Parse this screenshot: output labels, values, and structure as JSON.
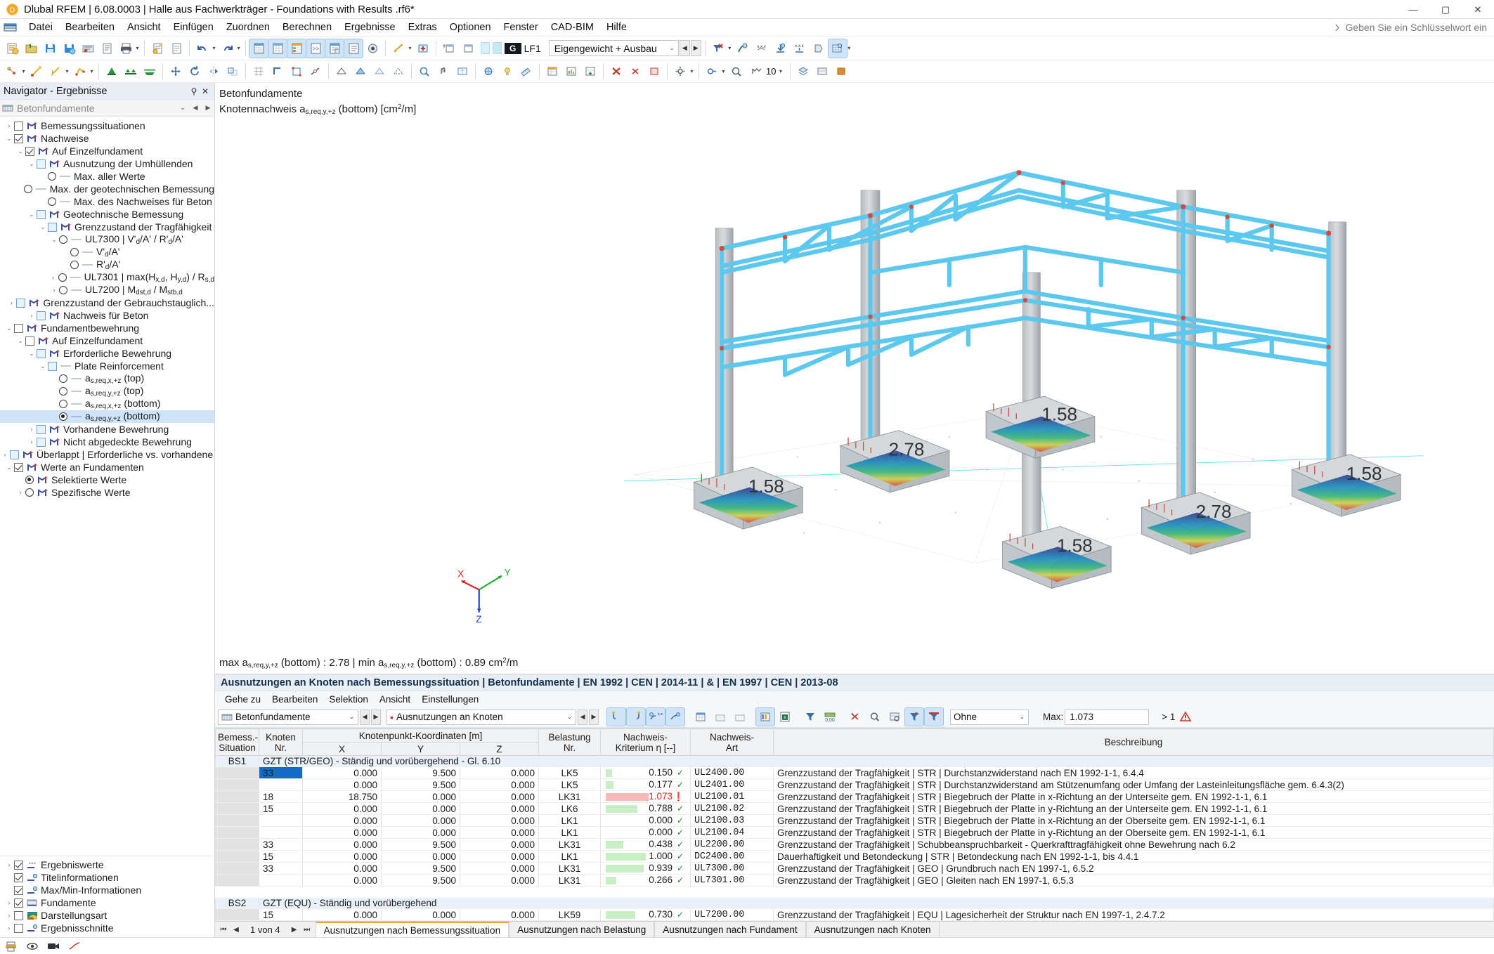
{
  "window": {
    "title": "Dlubal RFEM | 6.08.0003 | Halle aus Fachwerkträger - Foundations with Results .rf6*",
    "minimize": "—",
    "maximize": "▢",
    "close": "✕"
  },
  "menubar": {
    "items": [
      "Datei",
      "Bearbeiten",
      "Ansicht",
      "Einfügen",
      "Zuordnen",
      "Berechnen",
      "Ergebnisse",
      "Extras",
      "Optionen",
      "Fenster",
      "CAD-BIM",
      "Hilfe"
    ],
    "search_hint": "Geben Sie ein Schlüsselwort ein"
  },
  "toolbar": {
    "load_tag": "G",
    "load_case_no": "LF1",
    "load_case_name": "Eigengewicht + Ausbau",
    "prev": "◀",
    "next": "▶"
  },
  "navigator": {
    "header": "Navigator - Ergebnisse",
    "pin": "⚲",
    "close": "✕",
    "combo_value": "Betonfundamente",
    "tree": [
      {
        "depth": 0,
        "exp": "›",
        "ctrl": "cb",
        "checked": false,
        "icon": "result-icon",
        "label": "Bemessungssituationen"
      },
      {
        "depth": 0,
        "exp": "⌄",
        "ctrl": "cb",
        "checked": true,
        "icon": "result-icon",
        "label": "Nachweise"
      },
      {
        "depth": 1,
        "exp": "⌄",
        "ctrl": "cb",
        "checked": true,
        "icon": "result-icon",
        "label": "Auf Einzelfundament"
      },
      {
        "depth": 2,
        "exp": "⌄",
        "ctrl": "cbblue",
        "checked": false,
        "icon": "result-icon",
        "label": "Ausnutzung der Umhüllenden"
      },
      {
        "depth": 3,
        "exp": "",
        "ctrl": "rb",
        "checked": false,
        "icon": "dash",
        "label": "Max. aller Werte"
      },
      {
        "depth": 3,
        "exp": "",
        "ctrl": "rb",
        "checked": false,
        "icon": "dash",
        "label": "Max. der geotechnischen Bemessung"
      },
      {
        "depth": 3,
        "exp": "",
        "ctrl": "rb",
        "checked": false,
        "icon": "dash",
        "label": "Max. des Nachweises für Beton"
      },
      {
        "depth": 2,
        "exp": "⌄",
        "ctrl": "cbblue",
        "checked": false,
        "icon": "result-icon",
        "label": "Geotechnische Bemessung"
      },
      {
        "depth": 3,
        "exp": "⌄",
        "ctrl": "cbblue",
        "checked": false,
        "icon": "result-icon",
        "label": "Grenzzustand der Tragfähigkeit"
      },
      {
        "depth": 4,
        "exp": "⌄",
        "ctrl": "rb",
        "checked": false,
        "icon": "dash",
        "label": "UL7300 | V'd/A' / R'd/A'"
      },
      {
        "depth": 5,
        "exp": "",
        "ctrl": "rb",
        "checked": false,
        "icon": "dash",
        "label": "V'd/A'"
      },
      {
        "depth": 5,
        "exp": "",
        "ctrl": "rb",
        "checked": false,
        "icon": "dash",
        "label": "R'd/A'"
      },
      {
        "depth": 4,
        "exp": "›",
        "ctrl": "rb",
        "checked": false,
        "icon": "dash",
        "label": "UL7301 | max(Hx,d, Hy,d) / Rs,d"
      },
      {
        "depth": 4,
        "exp": "›",
        "ctrl": "rb",
        "checked": false,
        "icon": "dash",
        "label": "UL7200 | Mdst,d / Mstb,d"
      },
      {
        "depth": 3,
        "exp": "›",
        "ctrl": "cbblue",
        "checked": false,
        "icon": "result-icon",
        "label": "Grenzzustand der Gebrauchstauglich..."
      },
      {
        "depth": 2,
        "exp": "›",
        "ctrl": "cbblue",
        "checked": false,
        "icon": "result-icon",
        "label": "Nachweis für Beton"
      },
      {
        "depth": 0,
        "exp": "⌄",
        "ctrl": "cb",
        "checked": false,
        "icon": "result-icon",
        "label": "Fundamentbewehrung"
      },
      {
        "depth": 1,
        "exp": "⌄",
        "ctrl": "cb",
        "checked": false,
        "icon": "result-icon",
        "label": "Auf Einzelfundament"
      },
      {
        "depth": 2,
        "exp": "⌄",
        "ctrl": "cbblue",
        "checked": false,
        "icon": "result-icon",
        "label": "Erforderliche Bewehrung"
      },
      {
        "depth": 3,
        "exp": "⌄",
        "ctrl": "cbblue",
        "checked": false,
        "icon": "dash",
        "label": "Plate Reinforcement"
      },
      {
        "depth": 4,
        "exp": "",
        "ctrl": "rb",
        "checked": false,
        "icon": "dash",
        "label": "as,req,x,+z (top)"
      },
      {
        "depth": 4,
        "exp": "",
        "ctrl": "rb",
        "checked": false,
        "icon": "dash",
        "label": "as,req,y,+z (top)"
      },
      {
        "depth": 4,
        "exp": "",
        "ctrl": "rb",
        "checked": false,
        "icon": "dash",
        "label": "as,req,x,+z (bottom)"
      },
      {
        "depth": 4,
        "exp": "",
        "ctrl": "rb",
        "checked": true,
        "icon": "dash",
        "label": "as,req,y,+z (bottom)",
        "selected": true
      },
      {
        "depth": 2,
        "exp": "›",
        "ctrl": "cbblue",
        "checked": false,
        "icon": "result-icon",
        "label": "Vorhandene Bewehrung"
      },
      {
        "depth": 2,
        "exp": "›",
        "ctrl": "cbblue",
        "checked": false,
        "icon": "result-icon",
        "label": "Nicht abgedeckte Bewehrung"
      },
      {
        "depth": 2,
        "exp": "›",
        "ctrl": "cbblue",
        "checked": false,
        "icon": "result-icon",
        "label": "Überlappt | Erforderliche vs. vorhandene ..."
      },
      {
        "depth": 0,
        "exp": "⌄",
        "ctrl": "cb",
        "checked": true,
        "icon": "result-icon",
        "label": "Werte an Fundamenten"
      },
      {
        "depth": 1,
        "exp": "",
        "ctrl": "rb",
        "checked": true,
        "icon": "result-icon",
        "label": "Selektierte Werte"
      },
      {
        "depth": 1,
        "exp": "›",
        "ctrl": "rb",
        "checked": false,
        "icon": "result-icon",
        "label": "Spezifische Werte"
      }
    ],
    "bottom": [
      {
        "exp": "›",
        "checked": true,
        "icon": "values-icon",
        "label": "Ergebniswerte"
      },
      {
        "exp": "",
        "checked": true,
        "icon": "eye-icon",
        "label": "Titelinformationen"
      },
      {
        "exp": "",
        "checked": true,
        "icon": "eye-icon",
        "label": "Max/Min-Informationen"
      },
      {
        "exp": "›",
        "checked": true,
        "icon": "foundation-icon",
        "label": "Fundamente"
      },
      {
        "exp": "›",
        "checked": false,
        "icon": "colorscale-icon",
        "label": "Darstellungsart"
      },
      {
        "exp": "›",
        "checked": false,
        "icon": "eye-icon",
        "label": "Ergebnisschnitte"
      }
    ]
  },
  "viewport": {
    "title_line1": "Betonfundamente",
    "title_line2_prefix": "Knotennachweis a",
    "title_line2_sub": "s,req,y,+z",
    "title_line2_mid": " (bottom) [cm",
    "title_line2_sup": "2",
    "title_line2_suffix": "/m]",
    "minmax_max_label": "max a",
    "minmax_sub": "s,req,y,+z",
    "minmax_bottom": " (bottom)",
    "minmax_max_value": "2.78",
    "minmax_min_label": "min a",
    "minmax_min_value": "0.89",
    "minmax_unit": "cm",
    "minmax_unit_sup": "2",
    "minmax_unit_suffix": "/m",
    "foundation_labels": [
      "1.58",
      "2.78",
      "1.58",
      "1.58",
      "2.78",
      "1.58"
    ],
    "axis_x": "X",
    "axis_y": "Y",
    "axis_z": "Z"
  },
  "results": {
    "title": "Ausnutzungen an Knoten nach Bemessungssituation | Betonfundamente | EN 1992 | CEN | 2014-11 | & | EN 1997 | CEN | 2013-08",
    "menu": [
      "Gehe zu",
      "Bearbeiten",
      "Selektion",
      "Ansicht",
      "Einstellungen"
    ],
    "selector1": "Betonfundamente",
    "selector2": "Ausnutzungen an Knoten",
    "filter_value": "Ohne",
    "max_label": "Max:",
    "max_value": "1.073",
    "gt_label": "> 1"
  },
  "table": {
    "headers": {
      "bemess": "Bemess.-\nSituation",
      "knoten": "Knoten\nNr.",
      "koord_group": "Knotenpunkt-Koordinaten [m]",
      "x": "X",
      "y": "Y",
      "z": "Z",
      "belastung": "Belastung\nNr.",
      "nachweis_krit": "Nachweis-\nKriterium η [--]",
      "nachweis_art": "Nachweis-\nArt",
      "beschreibung": "Beschreibung"
    },
    "groups": [
      {
        "bs": "BS1",
        "title": "GZT (STR/GEO) - Ständig und vorübergehend - Gl. 6.10",
        "rows": [
          {
            "knoten": "33",
            "x": "0.000",
            "y": "9.500",
            "z": "0.000",
            "lk": "LK5",
            "eta": "0.150",
            "bar": 11,
            "status": "ok",
            "art": "UL2400.00",
            "desc": "Grenzzustand der Tragfähigkeit | STR | Durchstanzwiderstand nach EN 1992-1-1, 6.4.4",
            "selected": true
          },
          {
            "knoten": "",
            "x": "0.000",
            "y": "9.500",
            "z": "0.000",
            "lk": "LK5",
            "eta": "0.177",
            "bar": 13,
            "status": "ok",
            "art": "UL2401.00",
            "desc": "Grenzzustand der Tragfähigkeit | STR | Durchstanzwiderstand am Stützenumfang oder Umfang der Lasteinleitungsfläche gem. 6.4.3(2)"
          },
          {
            "knoten": "18",
            "x": "18.750",
            "y": "0.000",
            "z": "0.000",
            "lk": "LK31",
            "eta": "1.073",
            "bar": 72,
            "status": "bad",
            "art": "UL2100.01",
            "desc": "Grenzzustand der Tragfähigkeit | STR | Biegebruch der Platte in x-Richtung an der Unterseite gem. EN 1992-1-1, 6.1"
          },
          {
            "knoten": "15",
            "x": "0.000",
            "y": "0.000",
            "z": "0.000",
            "lk": "LK6",
            "eta": "0.788",
            "bar": 53,
            "status": "ok",
            "art": "UL2100.02",
            "desc": "Grenzzustand der Tragfähigkeit | STR | Biegebruch der Platte in y-Richtung an der Unterseite gem. EN 1992-1-1, 6.1"
          },
          {
            "knoten": "",
            "x": "0.000",
            "y": "0.000",
            "z": "0.000",
            "lk": "LK1",
            "eta": "0.000",
            "bar": 0,
            "status": "ok",
            "art": "UL2100.03",
            "desc": "Grenzzustand der Tragfähigkeit | STR | Biegebruch der Platte in x-Richtung an der Oberseite gem. EN 1992-1-1, 6.1"
          },
          {
            "knoten": "",
            "x": "0.000",
            "y": "0.000",
            "z": "0.000",
            "lk": "LK1",
            "eta": "0.000",
            "bar": 0,
            "status": "ok",
            "art": "UL2100.04",
            "desc": "Grenzzustand der Tragfähigkeit | STR | Biegebruch der Platte in y-Richtung an der Oberseite gem. EN 1992-1-1, 6.1"
          },
          {
            "knoten": "33",
            "x": "0.000",
            "y": "9.500",
            "z": "0.000",
            "lk": "LK31",
            "eta": "0.438",
            "bar": 29,
            "status": "ok",
            "art": "UL2200.00",
            "desc": "Grenzzustand der Tragfähigkeit | Schubbeanspruchbarkeit - Querkrafttragfähigkeit ohne Bewehrung nach 6.2"
          },
          {
            "knoten": "15",
            "x": "0.000",
            "y": "0.000",
            "z": "0.000",
            "lk": "LK1",
            "eta": "1.000",
            "bar": 67,
            "status": "ok",
            "art": "DC2400.00",
            "desc": "Dauerhaftigkeit und Betondeckung | STR | Betondeckung nach EN 1992-1-1, bis 4.4.1"
          },
          {
            "knoten": "33",
            "x": "0.000",
            "y": "9.500",
            "z": "0.000",
            "lk": "LK31",
            "eta": "0.939",
            "bar": 63,
            "status": "ok",
            "art": "UL7300.00",
            "desc": "Grenzzustand der Tragfähigkeit | GEO | Grundbruch nach EN 1997-1, 6.5.2"
          },
          {
            "knoten": "",
            "x": "0.000",
            "y": "9.500",
            "z": "0.000",
            "lk": "LK31",
            "eta": "0.266",
            "bar": 18,
            "status": "ok",
            "art": "UL7301.00",
            "desc": "Grenzzustand der Tragfähigkeit | GEO | Gleiten nach EN 1997-1, 6.5.3"
          }
        ]
      },
      {
        "bs": "BS2",
        "title": "GZT (EQU) - Ständig und vorübergehend",
        "rows": [
          {
            "knoten": "15",
            "x": "0.000",
            "y": "0.000",
            "z": "0.000",
            "lk": "LK59",
            "eta": "0.730",
            "bar": 49,
            "status": "ok",
            "art": "UL7200.00",
            "desc": "Grenzzustand der Tragfähigkeit | EQU | Lagesicherheit der Struktur nach EN 1997-1, 2.4.7.2"
          }
        ]
      }
    ]
  },
  "footer": {
    "first": "⏮",
    "prev": "◀",
    "page": "1 von 4",
    "next": "▶",
    "last": "⏭",
    "tabs": [
      {
        "label": "Ausnutzungen nach Bemessungssituation",
        "active": true
      },
      {
        "label": "Ausnutzungen nach Belastung",
        "active": false
      },
      {
        "label": "Ausnutzungen nach Fundament",
        "active": false
      },
      {
        "label": "Ausnutzungen nach Knoten",
        "active": false
      }
    ]
  },
  "colors": {
    "accent": "#1569c7",
    "ok": "#1d8a2b",
    "bad": "#d61f1f",
    "bar_ok": "#c8eec4",
    "bar_bad": "#f6b9b9",
    "header_bg": "#e8eef4",
    "selection": "#cfe4f8"
  }
}
